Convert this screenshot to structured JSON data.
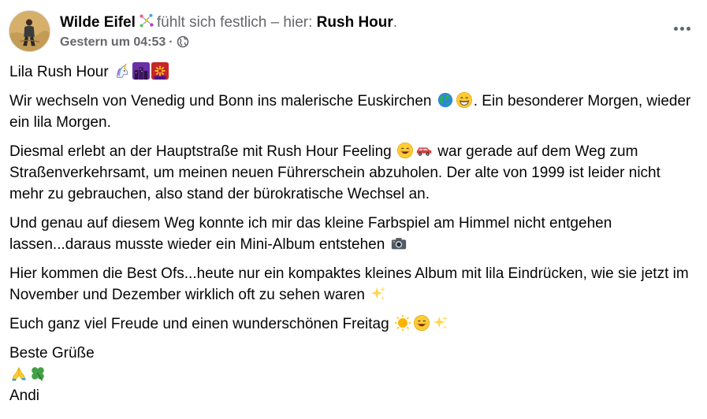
{
  "post": {
    "author": "Wilde Eifel",
    "feeling_text": "fühlt sich festlich – hier:",
    "feeling_object": "Rush Hour",
    "period": ".",
    "timestamp": "Gestern um 04:53",
    "separator": "·",
    "icons": {
      "activity": "party-popper-icon",
      "privacy": "globe-icon",
      "more": "more-options-icon"
    },
    "paragraphs": {
      "p1": "Lila Rush Hour",
      "p2a": "Wir wechseln von Venedig und Bonn ins malerische Euskirchen",
      "p2b": ". Ein besonderer Morgen, wieder ein lila Morgen.",
      "p3a": "Diesmal erlebt an der Hauptstraße mit Rush Hour Feeling",
      "p3b": "war gerade auf dem Weg zum Straßenverkehrsamt, um meinen neuen Führerschein abzuholen. Der alte von 1999 ist leider nicht mehr zu gebrauchen, also stand der bürokratische Wechsel an.",
      "p4": "Und genau auf diesem Weg konnte ich mir das kleine Farbspiel am Himmel nicht entgehen lassen...daraus musste wieder ein Mini-Album entstehen",
      "p5": "Hier kommen die Best Ofs...heute nur ein kompaktes kleines Album mit lila Eindrücken, wie sie jetzt im November und Dezember wirklich oft zu sehen waren",
      "p6": "Euch ganz viel Freude und einen wunderschönen Freitag",
      "p7": "Beste Grüße",
      "p9": "Andi"
    },
    "emojis": {
      "p1": [
        "unicorn-icon",
        "night-city-icon",
        "fireworks-icon"
      ],
      "p2": [
        "globe-earth-icon",
        "grinning-face-icon"
      ],
      "p3": [
        "smiling-face-icon",
        "car-icon"
      ],
      "p4": [
        "camera-icon"
      ],
      "p5": [
        "sparkles-icon"
      ],
      "p6": [
        "sun-icon",
        "smiling-face-icon",
        "sparkles-icon"
      ],
      "p8": [
        "folded-hands-icon",
        "four-leaf-clover-icon"
      ]
    }
  },
  "colors": {
    "text_primary": "#050505",
    "text_secondary": "#65676b",
    "background": "#ffffff"
  }
}
